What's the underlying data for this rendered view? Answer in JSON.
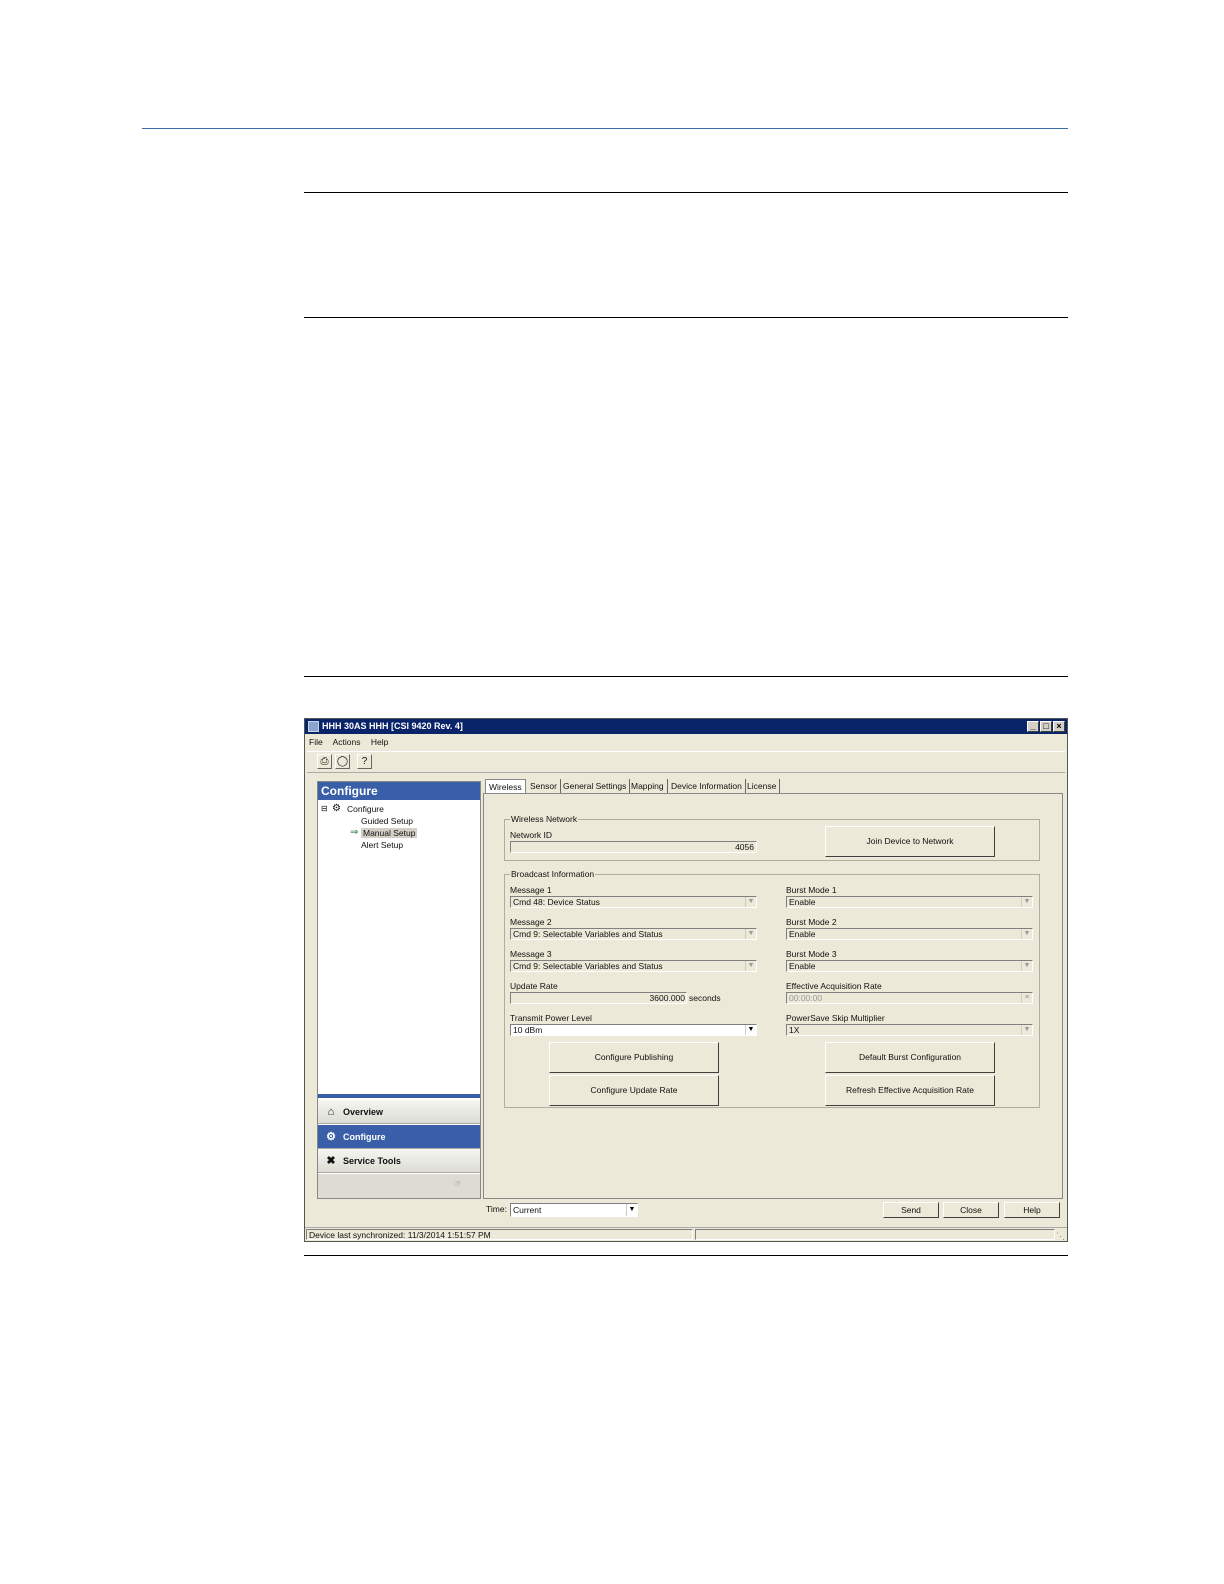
{
  "window": {
    "title": "HHH 30AS HHH [CSI 9420 Rev. 4]",
    "controls": [
      "_",
      "□",
      "×"
    ]
  },
  "menu": [
    "File",
    "Actions",
    "Help"
  ],
  "toolbar": {
    "icons": [
      "print-icon",
      "print-preview-icon",
      "help-icon"
    ]
  },
  "nav": {
    "header": "Configure",
    "tree": {
      "root": "Configure",
      "children": [
        "Guided Setup",
        "Manual Setup",
        "Alert Setup"
      ],
      "selected": "Manual Setup"
    },
    "buttons": [
      {
        "label": "Overview",
        "icon": "overview-icon"
      },
      {
        "label": "Configure",
        "icon": "configure-icon",
        "active": true
      },
      {
        "label": "Service Tools",
        "icon": "service-tools-icon"
      }
    ]
  },
  "tabs": [
    "Wireless",
    "Sensor",
    "General Settings",
    "Mapping",
    "Device Information",
    "License"
  ],
  "active_tab": "Wireless",
  "wireless_network": {
    "title": "Wireless Network",
    "network_id_label": "Network ID",
    "network_id_value": "4056",
    "join_button": "Join Device to Network"
  },
  "broadcast": {
    "title": "Broadcast Information",
    "message1_label": "Message 1",
    "message1_value": "Cmd 48: Device Status",
    "message2_label": "Message 2",
    "message2_value": "Cmd 9: Selectable Variables and Status",
    "message3_label": "Message 3",
    "message3_value": "Cmd 9: Selectable Variables and Status",
    "burst1_label": "Burst Mode 1",
    "burst1_value": "Enable",
    "burst2_label": "Burst Mode 2",
    "burst2_value": "Enable",
    "burst3_label": "Burst Mode 3",
    "burst3_value": "Enable",
    "update_rate_label": "Update Rate",
    "update_rate_value": "3600.000",
    "update_rate_unit": "seconds",
    "eff_acq_label": "Effective Acquisition Rate",
    "eff_acq_value": "00:00:00",
    "tx_power_label": "Transmit Power Level",
    "tx_power_value": "10 dBm",
    "powersave_label": "PowerSave Skip Multiplier",
    "powersave_value": "1X",
    "btn_configure_publishing": "Configure Publishing",
    "btn_default_burst": "Default Burst Configuration",
    "btn_configure_update_rate": "Configure Update Rate",
    "btn_refresh_eff": "Refresh Effective Acquisition Rate"
  },
  "bottom": {
    "time_label": "Time:",
    "time_value": "Current",
    "send": "Send",
    "close": "Close",
    "help": "Help"
  },
  "status": {
    "text": "Device last synchronized: 11/3/2014 1:51:57 PM"
  }
}
